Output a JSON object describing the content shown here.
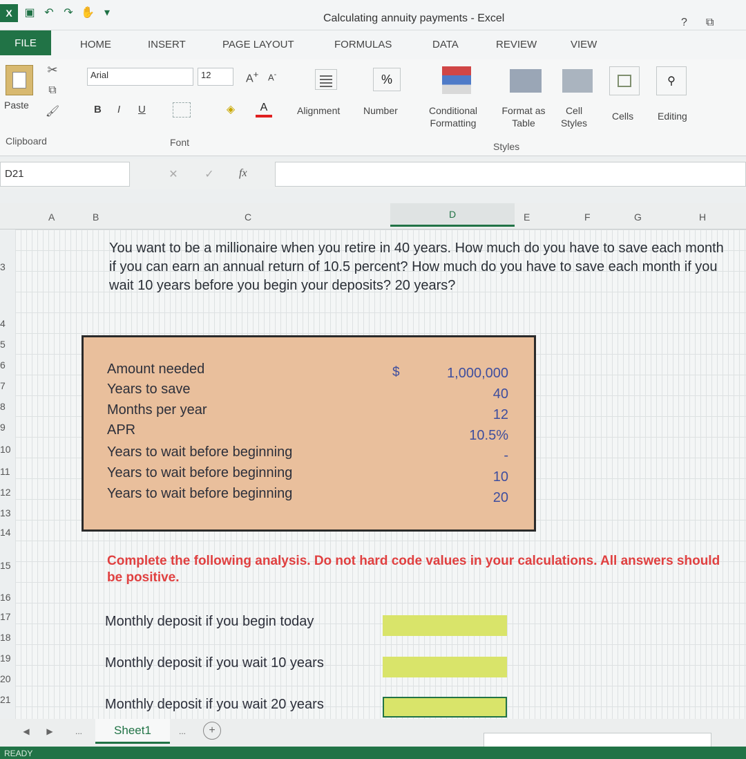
{
  "window": {
    "title": "Calculating annuity payments - Excel",
    "help": "?",
    "restore": "⧉"
  },
  "tabs": [
    "FILE",
    "HOME",
    "INSERT",
    "PAGE LAYOUT",
    "FORMULAS",
    "DATA",
    "REVIEW",
    "VIEW"
  ],
  "ribbon": {
    "paste": "Paste",
    "clipboard": "Clipboard",
    "font_name": "Arial",
    "font_size": "12",
    "font_group": "Font",
    "bold": "B",
    "italic": "I",
    "underline": "U",
    "alignment": "Alignment",
    "number": "Number",
    "percent": "%",
    "conditional": "Conditional Formatting",
    "format_table": "Format as Table",
    "cell_styles": "Cell Styles",
    "styles": "Styles",
    "cells": "Cells",
    "editing": "Editing"
  },
  "namebox": "D21",
  "fx": "fx",
  "columns": [
    "A",
    "B",
    "C",
    "D",
    "E",
    "F",
    "G",
    "H"
  ],
  "rows": [
    "3",
    "4",
    "5",
    "6",
    "7",
    "8",
    "9",
    "10",
    "11",
    "12",
    "13",
    "14",
    "15",
    "16",
    "17",
    "18",
    "19",
    "20",
    "21"
  ],
  "question": "You want to be a millionaire when you retire in 40 years. How much do you have to save each month if you can earn an annual return of 10.5 percent? How much do you have to save each month if you wait 10 years before you begin your deposits? 20 years?",
  "inputs": {
    "currency": "$",
    "items": [
      {
        "label": "Amount needed",
        "value": "1,000,000"
      },
      {
        "label": "Years to save",
        "value": "40"
      },
      {
        "label": "Months per year",
        "value": "12"
      },
      {
        "label": "APR",
        "value": "10.5%"
      },
      {
        "label": "Years to wait before beginning",
        "value": "-"
      },
      {
        "label": "Years to wait before beginning",
        "value": "10"
      },
      {
        "label": "Years to wait before beginning",
        "value": "20"
      }
    ]
  },
  "instructions": "Complete the following analysis. Do not hard code values in your calculations. All answers should be positive.",
  "questions": [
    "Monthly deposit if you begin today",
    "Monthly deposit if you wait 10 years",
    "Monthly deposit if you wait 20 years"
  ],
  "sheet": {
    "name": "Sheet1",
    "more": "...",
    "add": "+"
  },
  "status": "READY",
  "colors": {
    "accent": "#217346",
    "box": "#e9bf9c",
    "answer": "#d9e46a",
    "instruction": "#e04040"
  }
}
